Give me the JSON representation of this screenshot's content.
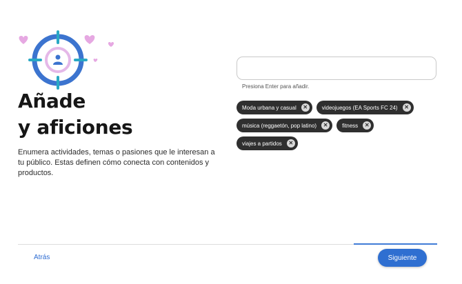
{
  "header": {
    "title_line1": "Añade",
    "title_line2": "y aficiones",
    "description": "Enumera actividades, temas o pasiones que le interesan a tu público. Estas definen cómo conecta con contenidos y productos."
  },
  "input": {
    "value": "",
    "placeholder": "",
    "hint": "Presiona Enter para añadir."
  },
  "chips": [
    {
      "label": "Moda urbana y casual"
    },
    {
      "label": "videojuegos (EA Sports FC 24)"
    },
    {
      "label": "música (reggaetón, pop latino)"
    },
    {
      "label": "fitness"
    },
    {
      "label": "viajes a partidos"
    }
  ],
  "footer": {
    "back_label": "Atrás",
    "next_label": "Siguiente",
    "progress": 0.2
  },
  "colors": {
    "accent": "#2f6fd1",
    "target_ring": "#3c74cf",
    "target_inner": "#e5b8e8",
    "crosshair": "#29a8c4",
    "hearts": "#e6a8e2",
    "chip_bg": "#2f2f2f"
  },
  "icons": [
    "target-icon",
    "heart-icon",
    "user-icon",
    "close-icon"
  ]
}
